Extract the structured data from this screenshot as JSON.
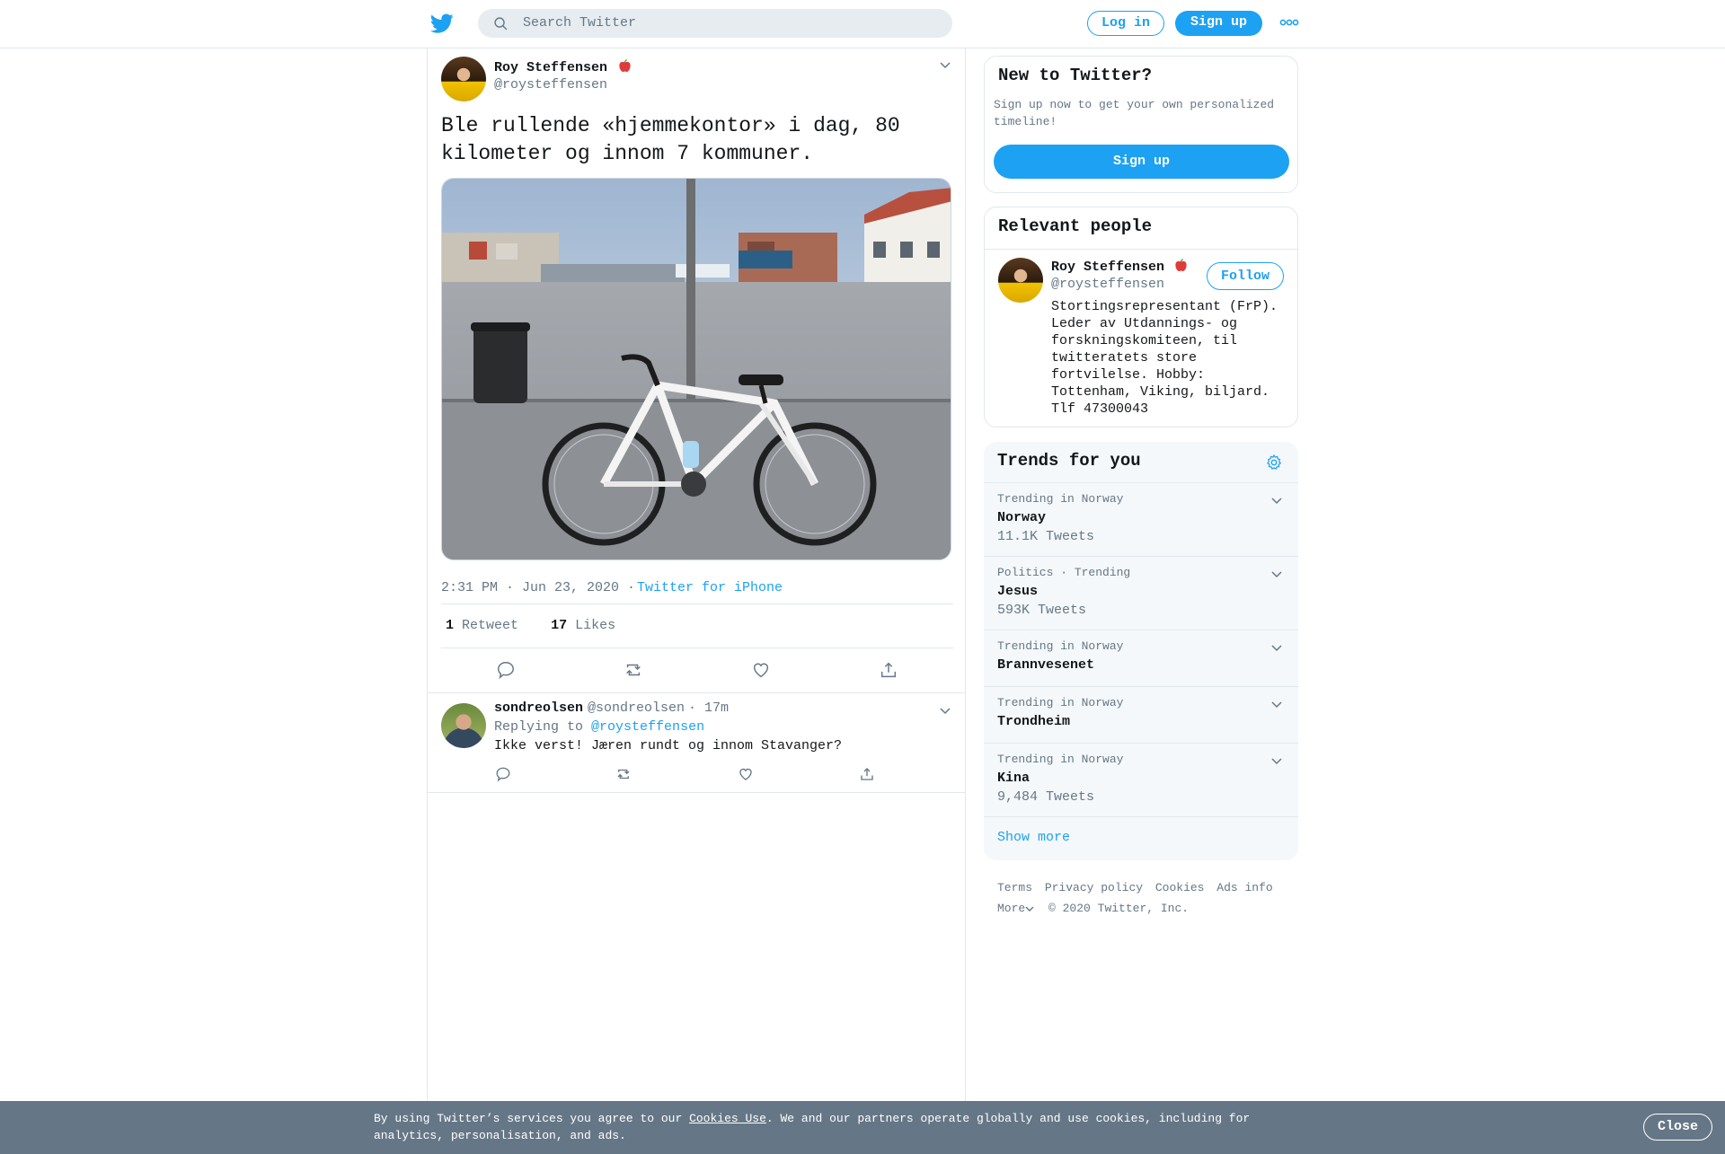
{
  "header": {
    "search_placeholder": "Search Twitter",
    "login_label": "Log in",
    "signup_label": "Sign up",
    "icons": [
      "twitter-bird-icon",
      "search-icon",
      "more-dots-icon"
    ]
  },
  "tweet": {
    "author_name": "Roy Steffensen",
    "author_handle": "@roysteffensen",
    "text": "Ble rullende «hjemmekontor» i dag, 80 kilometer og innom 7 kommuner.",
    "timestamp": "2:31 PM · Jun 23, 2020 ·",
    "source": "Twitter for iPhone",
    "retweet_count": "1",
    "retweet_label": "Retweet",
    "like_count": "17",
    "like_label": "Likes"
  },
  "reply": {
    "author_name": "sondreolsen",
    "author_handle": "@sondreolsen",
    "time": "· 17m",
    "replying_prefix": "Replying to",
    "replying_to": "@roysteffensen",
    "text": "Ikke verst! Jæren rundt og innom Stavanger?"
  },
  "sidebar": {
    "new_title": "New to Twitter?",
    "new_sub": "Sign up now to get your own personalized timeline!",
    "new_signup": "Sign up",
    "relevant_title": "Relevant people",
    "person": {
      "name": "Roy Steffensen",
      "handle": "@roysteffensen",
      "follow": "Follow",
      "bio": "Stortingsrepresentant (FrP). Leder av Utdannings- og forskningskomiteen, til twitteratets store fortvilelse. Hobby: Tottenham, Viking, biljard. Tlf 47300043"
    },
    "trends_title": "Trends for you",
    "trends": [
      {
        "meta": "Trending in Norway",
        "name": "Norway",
        "count": "11.1K Tweets"
      },
      {
        "meta": "Politics · Trending",
        "name": "Jesus",
        "count": "593K Tweets"
      },
      {
        "meta": "Trending in Norway",
        "name": "Brannvesenet",
        "count": ""
      },
      {
        "meta": "Trending in Norway",
        "name": "Trondheim",
        "count": ""
      },
      {
        "meta": "Trending in Norway",
        "name": "Kina",
        "count": "9,484 Tweets"
      }
    ],
    "show_more": "Show more"
  },
  "footer": {
    "links": [
      "Terms",
      "Privacy policy",
      "Cookies",
      "Ads info"
    ],
    "more": "More",
    "copyright": "© 2020 Twitter, Inc."
  },
  "cookie_bar": {
    "prefix": "By using Twitter’s services you agree to our",
    "link": "Cookies Use",
    "suffix": ". We and our partners operate globally and use cookies, including for analytics, personalisation, and ads.",
    "close": "Close"
  },
  "colors": {
    "accent": "#1da1f2",
    "secondary_text": "#657786",
    "cookie_bar": "#657786",
    "trends_bg": "#f5f8fa"
  }
}
